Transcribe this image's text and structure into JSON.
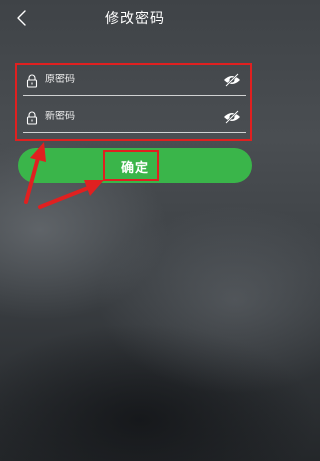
{
  "header": {
    "title": "修改密码",
    "back_icon": "back-chevron-icon"
  },
  "form": {
    "old_password": {
      "placeholder": "原密码",
      "lock_icon": "lock-icon",
      "toggle_icon": "eye-hidden-icon"
    },
    "new_password": {
      "placeholder": "新密码",
      "lock_icon": "lock-icon",
      "toggle_icon": "eye-hidden-icon"
    }
  },
  "actions": {
    "confirm_label": "确定"
  },
  "colors": {
    "accent_green": "#3ab54a",
    "annotation_red": "#e02020",
    "text": "#ffffff"
  }
}
